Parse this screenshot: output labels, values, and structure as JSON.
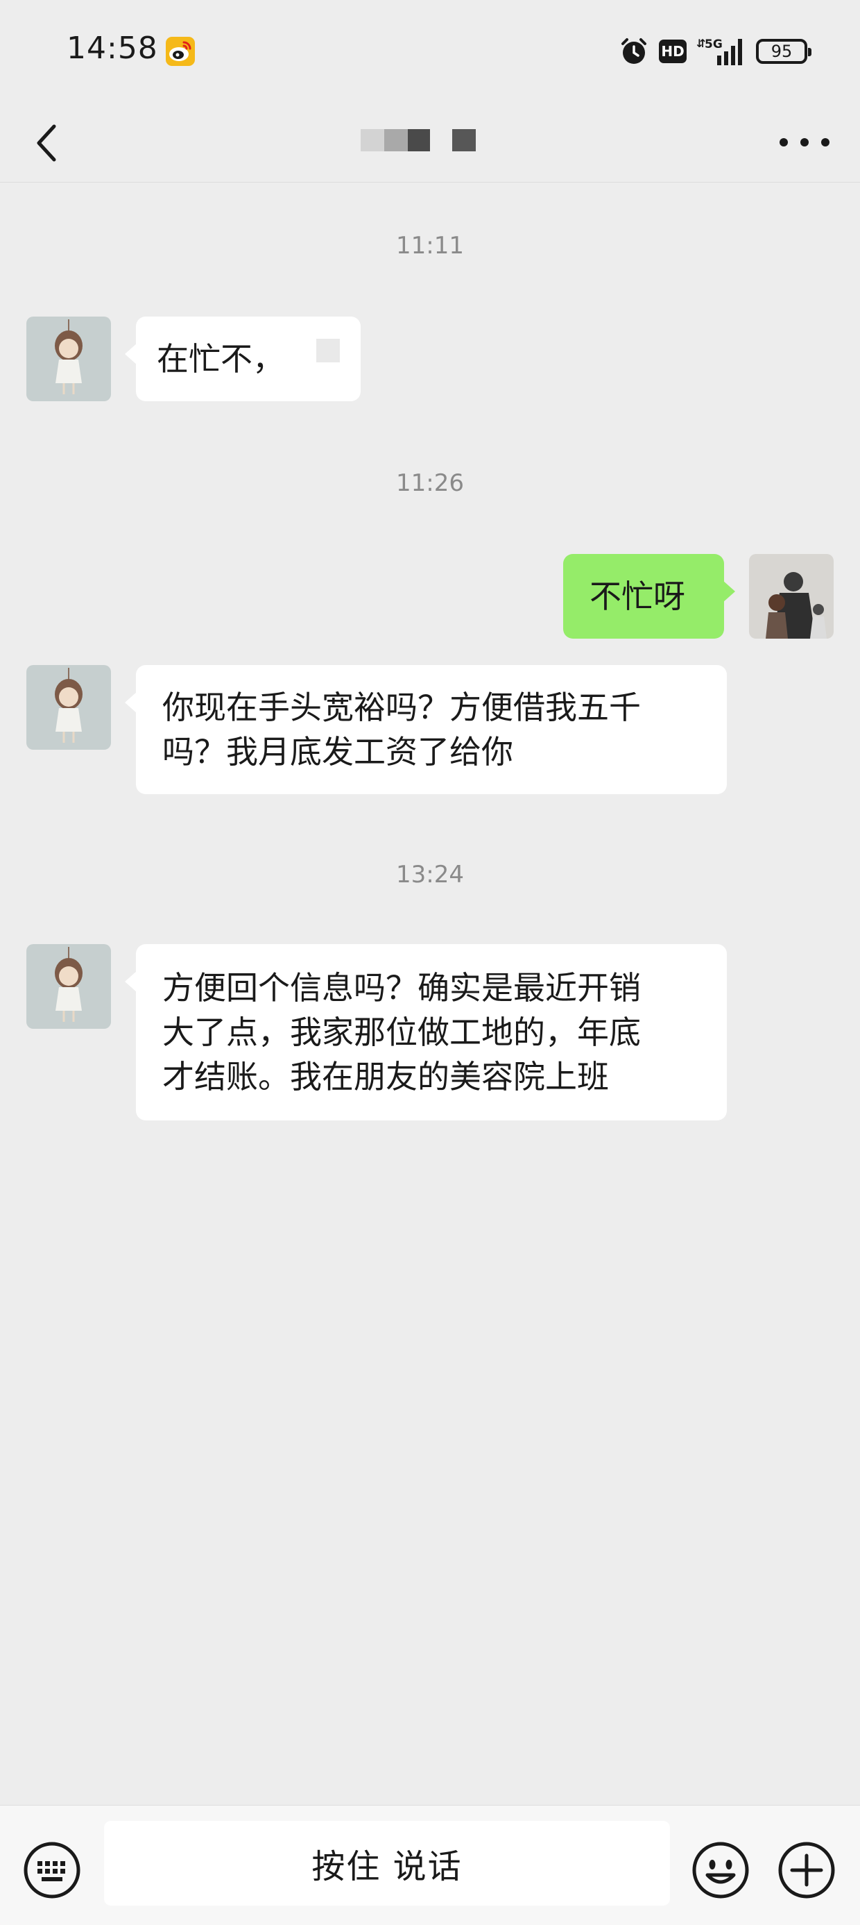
{
  "status_bar": {
    "time": "14:58",
    "network": "5G",
    "hd": "HD",
    "battery": "95"
  },
  "header": {
    "contact_name": ""
  },
  "messages": [
    {
      "type": "time",
      "text": "11:11"
    },
    {
      "type": "msg",
      "side": "left",
      "text": "在忙不，"
    },
    {
      "type": "time",
      "text": "11:26"
    },
    {
      "type": "msg",
      "side": "right",
      "text": "不忙呀"
    },
    {
      "type": "msg",
      "side": "left",
      "text": "你现在手头宽裕吗？方便借我五千\n吗？我月底发工资了给你"
    },
    {
      "type": "time",
      "text": "13:24"
    },
    {
      "type": "msg",
      "side": "left",
      "text": "方便回个信息吗？确实是最近开销\n大了点，我家那位做工地的，年底\n才结账。我在朋友的美容院上班"
    }
  ],
  "input_bar": {
    "hold_to_talk": "按住 说话"
  },
  "colors": {
    "background": "#ededed",
    "outgoing_bubble": "#95ec69",
    "incoming_bubble": "#ffffff"
  },
  "icons": [
    "back-icon",
    "more-icon",
    "keyboard-icon",
    "emoji-icon",
    "plus-icon",
    "weibo-icon",
    "alarm-icon",
    "signal-icon",
    "battery-icon"
  ]
}
